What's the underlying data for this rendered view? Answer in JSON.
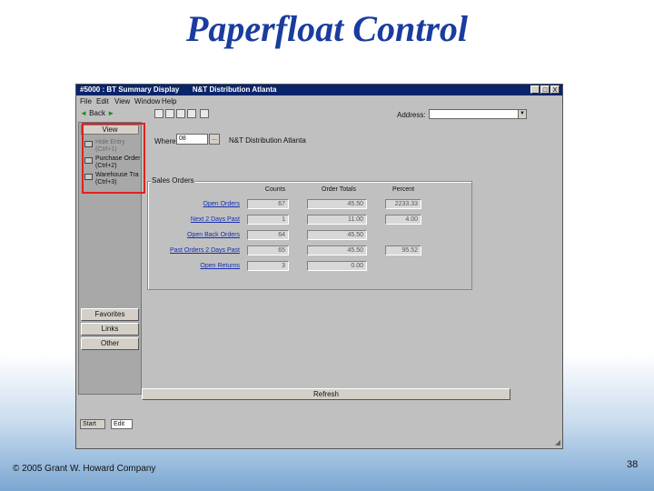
{
  "slide": {
    "title": "Paperfloat Control",
    "footer": "© 2005 Grant W. Howard Company",
    "page_number": "38"
  },
  "window": {
    "title_left": "#5000 : BT Summary Display",
    "title_right": "N&T Distribution Atlanta",
    "controls": {
      "minimize": "_",
      "maximize": "□",
      "close": "X"
    }
  },
  "menu": [
    "File",
    "Edit",
    "View",
    "Window",
    "Help"
  ],
  "toolbar": {
    "back_label": "Back",
    "back_arrow": "◄",
    "forward_arrow": "►",
    "address_label": "Address:",
    "address_value": "",
    "address_dropdown": "▼"
  },
  "leftbar": {
    "view_label": "View",
    "items": [
      {
        "line1": "Hide Entry",
        "line2": "(Ctrl+1)",
        "dim": true
      },
      {
        "line1": "Purchase Order",
        "line2": "(Ctrl+2)",
        "dim": false
      },
      {
        "line1": "Warehouse Tra",
        "line2": "(Ctrl+3)",
        "dim": false
      }
    ],
    "groups": [
      "Favorites",
      "Links",
      "Other"
    ]
  },
  "where": {
    "label": "Where",
    "value": "08",
    "browse": "...",
    "name": "N&T Distribution Atlanta"
  },
  "sales_orders": {
    "title": "Sales Orders",
    "columns": [
      "Counts",
      "Order Totals",
      "Percent"
    ],
    "rows": [
      {
        "label": "Open Orders",
        "count": "67",
        "total": "45.50",
        "percent": "2233.33"
      },
      {
        "label": "Next 2 Days Past",
        "count": "1",
        "total": "11.00",
        "percent": "4.00"
      },
      {
        "label": "Open Back Orders",
        "count": "64",
        "total": "45.50",
        "percent": ""
      },
      {
        "label": "Past Orders 2 Days Past",
        "count": "65",
        "total": "45.50",
        "percent": "95.52"
      },
      {
        "label": "Open Returns",
        "count": "3",
        "total": "0.00",
        "percent": ""
      }
    ]
  },
  "refresh_label": "Refresh",
  "statusbar": {
    "start_label": "Start",
    "edit_label": "Edit"
  }
}
